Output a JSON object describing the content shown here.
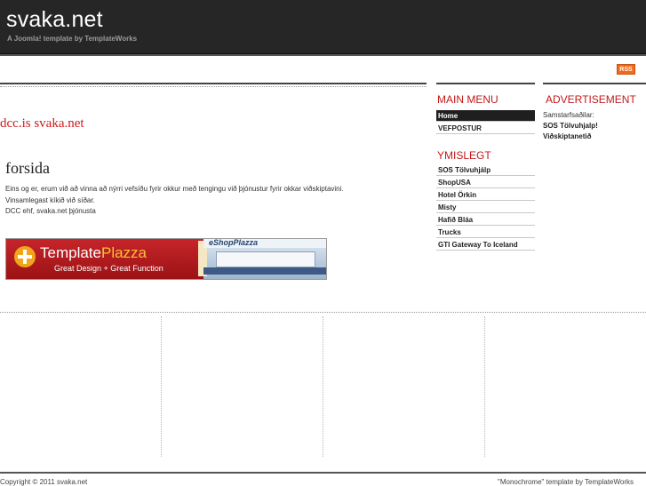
{
  "header": {
    "site_title": "svaka.net",
    "subtitle": "A Joomla! template by TemplateWorks"
  },
  "toolbar": {
    "rss_label": "RSS"
  },
  "content": {
    "site_heading": "dcc.is svaka.net",
    "article_title": "forsida",
    "body_lines": [
      "Eins og er, erum við að vinna að nýrri vefsíðu fyrir okkur með tengingu við þjónustur fyrir okkar viðskiptavini.",
      "Vinsamlegast kíkið við síðar.",
      "DCC ehf, svaka.net þjónusta"
    ],
    "banner": {
      "brand_part1": "Template",
      "brand_part2": "Plazza",
      "tagline": "Great Design + Great Function",
      "screenshot_logo": "eShopPlazza"
    }
  },
  "main_menu": {
    "heading": "MAIN MENU",
    "items": [
      {
        "label": "Home",
        "active": true
      },
      {
        "label": "VEFPOSTUR",
        "active": false
      }
    ]
  },
  "ymislegt": {
    "heading": "YMISLEGT",
    "items": [
      {
        "label": "SOS Tölvuhjálp"
      },
      {
        "label": "ShopUSA"
      },
      {
        "label": "Hotel Örkin"
      },
      {
        "label": "Misty"
      },
      {
        "label": "Hafið Bláa"
      },
      {
        "label": "Trucks"
      },
      {
        "label": "GTI Gateway To Iceland"
      }
    ]
  },
  "advertisement": {
    "heading": "ADVERTISEMENT",
    "label": "Samstarfsaðilar:",
    "links": [
      {
        "label": "SOS Tölvuhjalp!"
      },
      {
        "label": "Viðskiptanetið"
      }
    ]
  },
  "footer": {
    "copyright": "Copyright © 2011 svaka.net",
    "credit": "\"Monochrome\" template by TemplateWorks"
  },
  "colors": {
    "header_bg": "#262626",
    "accent_red": "#c11a1a",
    "rss_orange": "#f26a1b",
    "menu_active_bg": "#1f1f1f"
  }
}
